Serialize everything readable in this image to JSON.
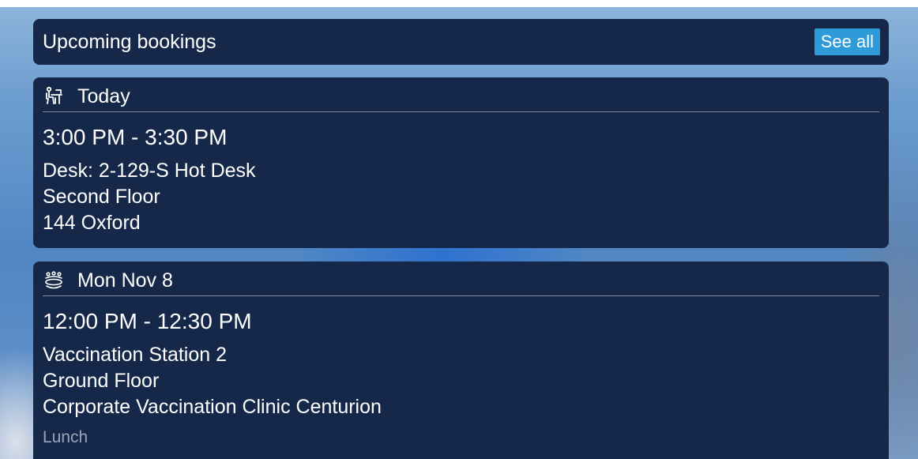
{
  "header": {
    "title": "Upcoming bookings",
    "see_all_label": "See all"
  },
  "bookings": [
    {
      "icon": "desk-person-icon",
      "date": "Today",
      "time": "3:00 PM - 3:30 PM",
      "resource": "Desk: 2-129-S Hot Desk",
      "floor": "Second Floor",
      "building": "144 Oxford"
    },
    {
      "icon": "meeting-table-icon",
      "date": "Mon Nov 8",
      "time": "12:00 PM - 12:30 PM",
      "resource": "Vaccination Station 2",
      "floor": "Ground Floor",
      "building": "Corporate Vaccination Clinic Centurion",
      "note": "Lunch"
    }
  ],
  "colors": {
    "card_background": "#16284a",
    "accent_button": "#2e9ad8",
    "text_primary": "#ffffff",
    "text_muted": "#9aa4b8"
  }
}
